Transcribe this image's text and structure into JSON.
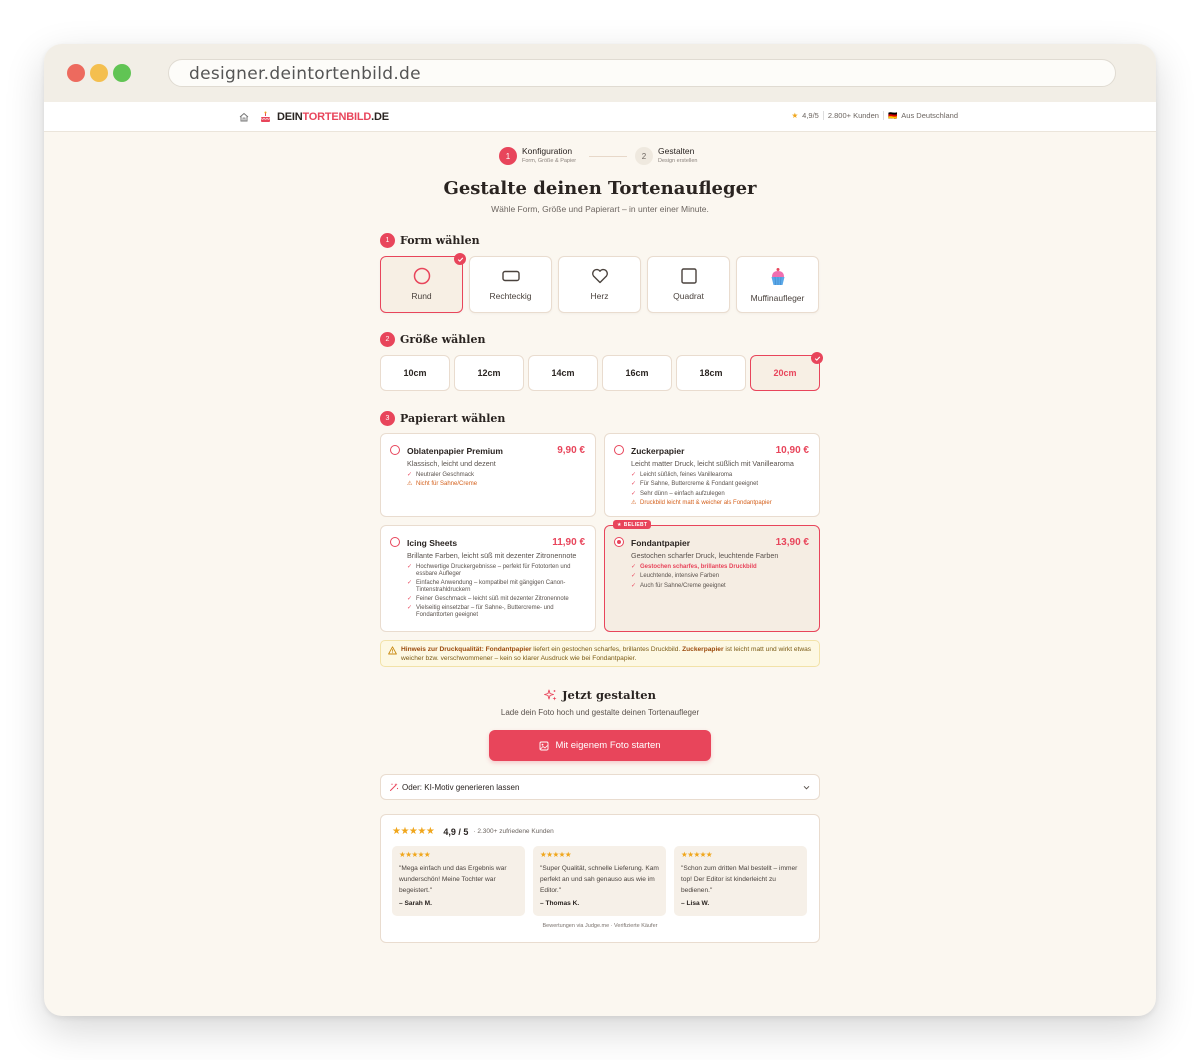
{
  "browser": {
    "url": "designer.deintortenbild.de"
  },
  "nav": {
    "brand_prefix": "DEIN",
    "brand_highlight": "TORTENBILD",
    "brand_suffix": ".DE",
    "rating_star": "★",
    "rating": "4,9/5",
    "customers": "2.800+ Kunden",
    "origin_flag": "🇩🇪",
    "origin": "Aus Deutschland"
  },
  "stepper": {
    "steps": [
      {
        "number": "1",
        "title": "Konfiguration",
        "subtitle": "Form, Größe & Papier"
      },
      {
        "number": "2",
        "title": "Gestalten",
        "subtitle": "Design erstellen"
      }
    ]
  },
  "header": {
    "title": "Gestalte deinen Tortenaufleger",
    "subtitle": "Wähle Form, Größe und Papierart – in unter einer Minute."
  },
  "shape_section": {
    "number": "1",
    "title": "Form wählen",
    "options": [
      {
        "label": "Rund",
        "icon": "circle-icon",
        "selected": true
      },
      {
        "label": "Rechteckig",
        "icon": "rectangle-icon",
        "selected": false
      },
      {
        "label": "Herz",
        "icon": "heart-icon",
        "selected": false
      },
      {
        "label": "Quadrat",
        "icon": "square-icon",
        "selected": false
      },
      {
        "label": "Muffinaufleger",
        "icon": "cupcake-icon",
        "selected": false
      }
    ]
  },
  "size_section": {
    "number": "2",
    "title": "Größe wählen",
    "options": [
      {
        "label": "10cm",
        "selected": false
      },
      {
        "label": "12cm",
        "selected": false
      },
      {
        "label": "14cm",
        "selected": false
      },
      {
        "label": "16cm",
        "selected": false
      },
      {
        "label": "18cm",
        "selected": false
      },
      {
        "label": "20cm",
        "selected": true
      }
    ]
  },
  "paper_section": {
    "number": "3",
    "title": "Papierart wählen",
    "options": [
      {
        "name": "Oblatenpapier Premium",
        "price": "9,90 €",
        "description": "Klassisch, leicht und dezent",
        "selected": false,
        "features": [
          {
            "text": "Neutraler Geschmack",
            "type": "check"
          },
          {
            "text": "Nicht für Sahne/Creme",
            "type": "warn"
          }
        ]
      },
      {
        "name": "Zuckerpapier",
        "price": "10,90 €",
        "description": "Leicht matter Druck, leicht süßlich mit Vanillearoma",
        "selected": false,
        "features": [
          {
            "text": "Leicht süßlich, feines Vanillearoma",
            "type": "check"
          },
          {
            "text": "Für Sahne, Buttercreme & Fondant geeignet",
            "type": "check"
          },
          {
            "text": "Sehr dünn – einfach aufzulegen",
            "type": "check"
          },
          {
            "text": "Druckbild leicht matt & weicher als Fondantpapier",
            "type": "warn"
          }
        ]
      },
      {
        "name": "Icing Sheets",
        "price": "11,90 €",
        "description": "Brillante Farben, leicht süß mit dezenter Zitronennote",
        "selected": false,
        "features": [
          {
            "text": "Hochwertige Druckergebnisse – perfekt für Fototorten und essbare Aufleger",
            "type": "check"
          },
          {
            "text": "Einfache Anwendung – kompatibel mit gängigen Canon-Tintenstrahldruckern",
            "type": "check"
          },
          {
            "text": "Feiner Geschmack – leicht süß mit dezenter Zitronennote",
            "type": "check"
          },
          {
            "text": "Vielseitig einsetzbar – für Sahne-, Buttercreme- und Fondanttorten geeignet",
            "type": "check"
          }
        ]
      },
      {
        "name": "Fondantpapier",
        "price": "13,90 €",
        "description": "Gestochen scharfer Druck, leuchtende Farben",
        "selected": true,
        "badge": "BELIEBT",
        "features": [
          {
            "text": "Gestochen scharfes, brillantes Druckbild",
            "type": "highlight"
          },
          {
            "text": "Leuchtende, intensive Farben",
            "type": "check"
          },
          {
            "text": "Auch für Sahne/Creme geeignet",
            "type": "check"
          }
        ]
      }
    ]
  },
  "hint": {
    "label": "Hinweis zur Druckqualität:",
    "term1": "Fondantpapier",
    "text1": " liefert ein gestochen scharfes, brillantes Druckbild. ",
    "term2": "Zuckerpapier",
    "text2": " ist leicht matt und wirkt etwas weicher bzw. verschwommener – kein so klarer Ausdruck wie bei Fondantpapier."
  },
  "cta": {
    "title": "Jetzt gestalten",
    "subtitle": "Lade dein Foto hoch und gestalte deinen Tortenaufleger",
    "button_label": "Mit eigenem Foto starten"
  },
  "ai_option": {
    "label": "Oder: KI-Motiv generieren lassen"
  },
  "reviews": {
    "stars": "★★★★★",
    "rating": "4,9 / 5",
    "count": "· 2.300+ zufriedene Kunden",
    "items": [
      {
        "stars": "★★★★★",
        "text": "\"Mega einfach und das Ergebnis war wunderschön! Meine Tochter war begeistert.\"",
        "author": "– Sarah M."
      },
      {
        "stars": "★★★★★",
        "text": "\"Super Qualität, schnelle Lieferung. Kam perfekt an und sah genauso aus wie im Editor.\"",
        "author": "– Thomas K."
      },
      {
        "stars": "★★★★★",
        "text": "\"Schon zum dritten Mal bestellt – immer top! Der Editor ist kinderleicht zu bedienen.\"",
        "author": "– Lisa W."
      }
    ],
    "footer": "Bewertungen via Judge.me · Verifizierte Käufer"
  },
  "colors": {
    "accent": "#e8455b",
    "background": "#fbf7f0",
    "star": "#f0a61c",
    "warning": "#d4611d"
  }
}
